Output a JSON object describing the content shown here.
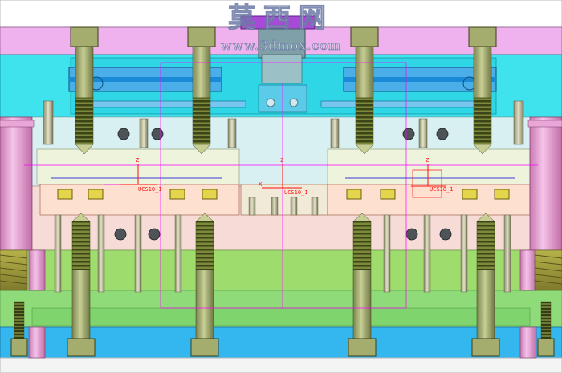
{
  "watermark": {
    "title": "莫西网",
    "url": "www.3dmox.com"
  },
  "annotations": {
    "axis_letter": "Z",
    "x_axis_letter": "X",
    "part_label_left": "UCS10_1",
    "part_label_center": "UCS10_1",
    "part_label_right": "UCS10_1"
  },
  "colors": {
    "top_clamp_plate": "#f0b2ee",
    "cavity_plate": "#3fe3ee",
    "stripper_plate": "#d9f0f3",
    "core_plate": "#f7dbd6",
    "support_plate": "#9edc6e",
    "ejector_area": "#8fdb7a",
    "bottom_clamp_plate": "#33b7ee",
    "pillar": "#ef9fda",
    "bolt": "#9aa56a",
    "slider": "#e4d54c",
    "annotation_red": "#ff1010",
    "centerline": "#ff00ff",
    "watermark": "#6d7aa6"
  }
}
